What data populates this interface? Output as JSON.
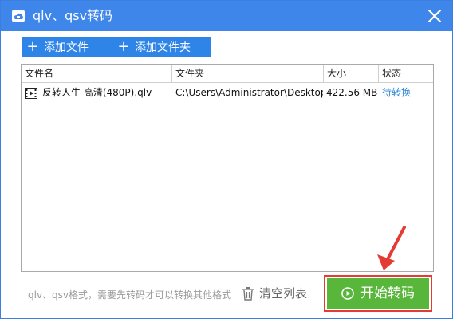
{
  "window": {
    "title": "qlv、qsv转码",
    "title_icon": "app-logo-icon",
    "close_icon": "close-icon"
  },
  "toolbar": {
    "add_file_label": "添加文件",
    "add_folder_label": "添加文件夹"
  },
  "table": {
    "headers": [
      "文件名",
      "文件夹",
      "大小",
      "状态"
    ],
    "rows": [
      {
        "name": "反转人生 高清(480P).qlv",
        "folder": "C:\\Users\\Administrator\\Desktop",
        "size": "422.56 MB",
        "status": "待转换"
      }
    ]
  },
  "footer": {
    "note": "qlv、qsv格式，需要先转码才可以转换其他格式",
    "clear_label": "清空列表",
    "start_label": "开始转码"
  },
  "colors": {
    "titlebar": "#3f86ea",
    "toolbar_button": "#2f84e8",
    "start_button": "#58b63a",
    "highlight": "#e53b35",
    "status": "#2d86d6"
  }
}
